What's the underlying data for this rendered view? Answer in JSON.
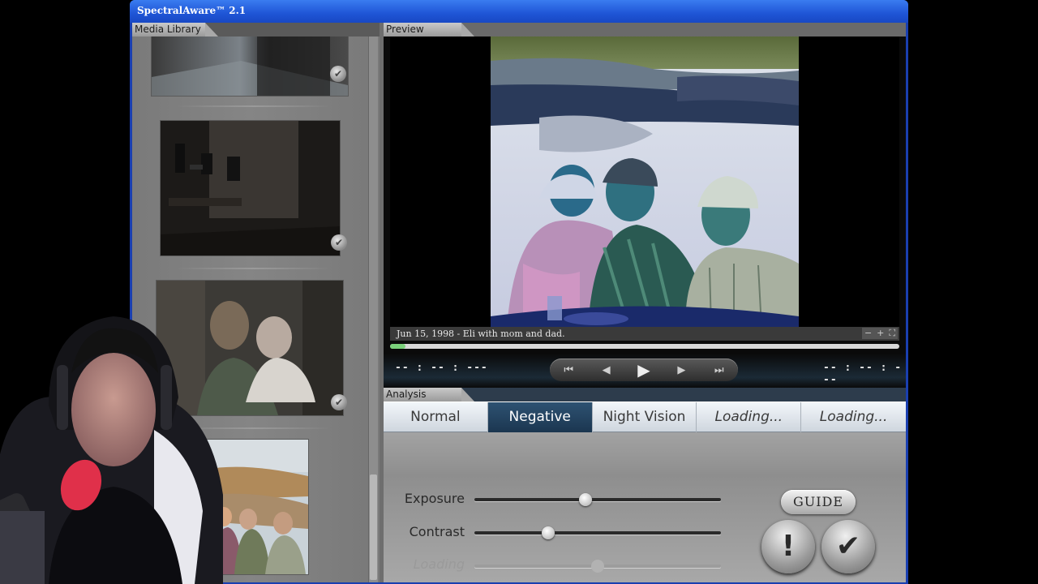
{
  "window": {
    "title": "SpectralAware™ 2.1"
  },
  "media_library": {
    "label": "Media Library",
    "selected_item": 4,
    "items_checked": [
      true,
      true,
      true,
      false
    ]
  },
  "preview": {
    "label": "Preview",
    "caption": "Jun 15, 1998 - Eli with mom and dad.",
    "zoom_out": "−",
    "zoom_in": "+",
    "fullscreen_icon": "fullscreen-icon",
    "progress": 0.03,
    "time_elapsed": "-- : -- : ---",
    "time_total": "-- : -- : ---"
  },
  "transport": {
    "skip_back": "⏮",
    "step_back": "◀",
    "play": "▶",
    "step_forward": "▶",
    "skip_forward": "⏭"
  },
  "analysis": {
    "label": "Analysis",
    "modes": [
      {
        "label": "Normal",
        "active": false
      },
      {
        "label": "Negative",
        "active": true
      },
      {
        "label": "Night Vision",
        "active": false
      },
      {
        "label": "Loading...",
        "active": false
      },
      {
        "label": "Loading...",
        "active": false
      }
    ],
    "sliders": [
      {
        "label": "Exposure",
        "value": 0.45,
        "enabled": true
      },
      {
        "label": "Contrast",
        "value": 0.3,
        "enabled": true
      },
      {
        "label": "Loading",
        "value": 0.5,
        "enabled": false
      }
    ],
    "guide_label": "GUIDE",
    "alert_label": "!",
    "confirm_label": "✔"
  },
  "colors": {
    "titlebar": "#1f55d6",
    "active_tab": "#1b3650",
    "progress": "#7ad07a"
  }
}
